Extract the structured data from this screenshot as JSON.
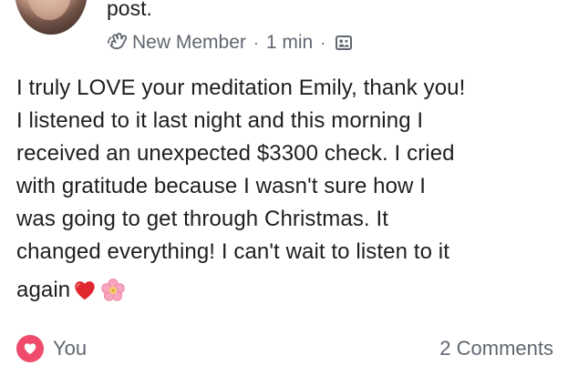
{
  "post": {
    "header_text": "post.",
    "author_badge": "New Member",
    "timestamp": "1 min",
    "privacy_icon": "group-privacy-icon",
    "body_lines": [
      "I truly LOVE your meditation Emily, thank you!",
      "I listened to it last night and this morning I",
      "received an unexpected $3300 check. I cried",
      "with gratitude because I wasn't sure how I",
      "was going to get through Christmas. It",
      "changed everything! I can't wait to listen to it"
    ],
    "last_line": "again",
    "emojis": [
      "red-heart",
      "cherry-blossom"
    ],
    "reactions": {
      "type": "love",
      "label": "You"
    },
    "comments_label": "2 Comments"
  },
  "colors": {
    "primary_text": "#1c1e21",
    "secondary_text": "#606770",
    "love_reaction": "#f04b6b"
  },
  "icons": {
    "badge": "waving-hand-icon",
    "privacy": "image-group-icon",
    "reaction": "heart-icon"
  }
}
